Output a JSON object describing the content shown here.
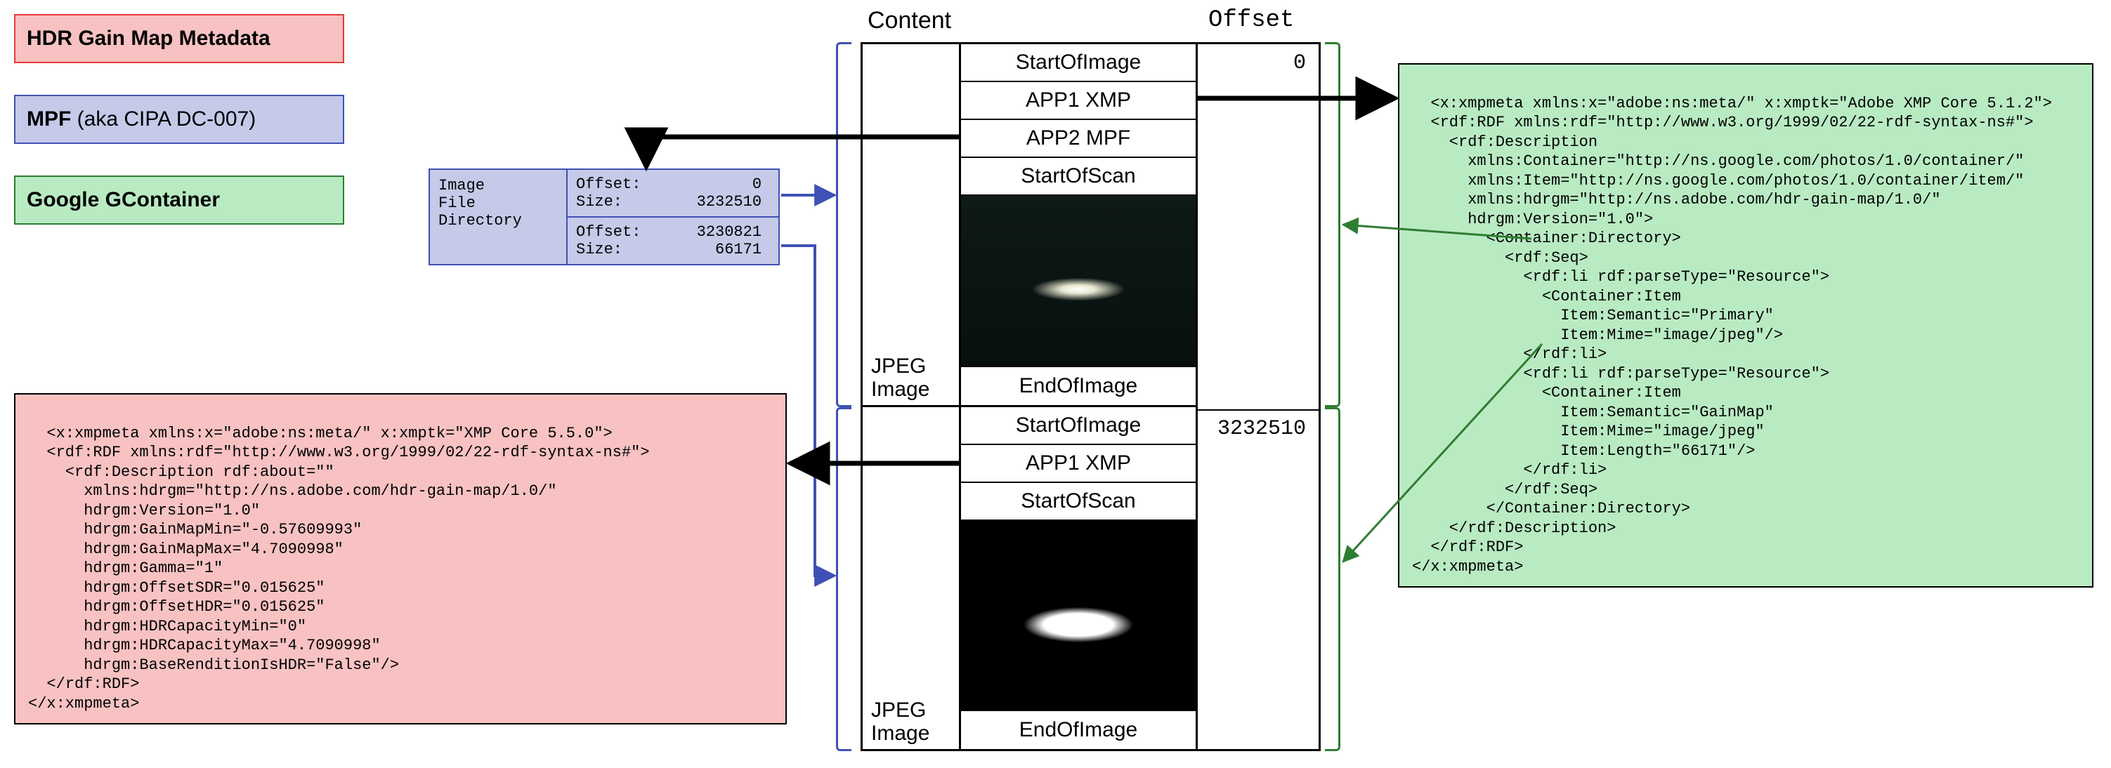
{
  "legend": {
    "hdr": "HDR Gain Map Metadata",
    "mpf_bold": "MPF",
    "mpf_plain": " (aka CIPA DC-007)",
    "gcont": "Google GContainer"
  },
  "titles": {
    "content": "Content",
    "offset": "Offset",
    "jpeg": "JPEG\nImage"
  },
  "ifd": {
    "label": "Image\nFile\nDirectory",
    "e0": "Offset:            0\nSize:        3232510",
    "e1": "Offset:      3230821\nSize:          66171"
  },
  "content": {
    "soi": "StartOfImage",
    "app1": "APP1 XMP",
    "app2": "APP2 MPF",
    "sos": "StartOfScan",
    "eoi": "EndOfImage"
  },
  "offsets": {
    "o0": "0",
    "o1": "3232510"
  },
  "xmp_hdrgm": "<x:xmpmeta xmlns:x=\"adobe:ns:meta/\" x:xmptk=\"XMP Core 5.5.0\">\n  <rdf:RDF xmlns:rdf=\"http://www.w3.org/1999/02/22-rdf-syntax-ns#\">\n    <rdf:Description rdf:about=\"\"\n      xmlns:hdrgm=\"http://ns.adobe.com/hdr-gain-map/1.0/\"\n      hdrgm:Version=\"1.0\"\n      hdrgm:GainMapMin=\"-0.57609993\"\n      hdrgm:GainMapMax=\"4.7090998\"\n      hdrgm:Gamma=\"1\"\n      hdrgm:OffsetSDR=\"0.015625\"\n      hdrgm:OffsetHDR=\"0.015625\"\n      hdrgm:HDRCapacityMin=\"0\"\n      hdrgm:HDRCapacityMax=\"4.7090998\"\n      hdrgm:BaseRenditionIsHDR=\"False\"/>\n  </rdf:RDF>\n</x:xmpmeta>",
  "xmp_gcont": "<x:xmpmeta xmlns:x=\"adobe:ns:meta/\" x:xmptk=\"Adobe XMP Core 5.1.2\">\n  <rdf:RDF xmlns:rdf=\"http://www.w3.org/1999/02/22-rdf-syntax-ns#\">\n    <rdf:Description\n      xmlns:Container=\"http://ns.google.com/photos/1.0/container/\"\n      xmlns:Item=\"http://ns.google.com/photos/1.0/container/item/\"\n      xmlns:hdrgm=\"http://ns.adobe.com/hdr-gain-map/1.0/\"\n      hdrgm:Version=\"1.0\">\n        <Container:Directory>\n          <rdf:Seq>\n            <rdf:li rdf:parseType=\"Resource\">\n              <Container:Item\n                Item:Semantic=\"Primary\"\n                Item:Mime=\"image/jpeg\"/>\n            </rdf:li>\n            <rdf:li rdf:parseType=\"Resource\">\n              <Container:Item\n                Item:Semantic=\"GainMap\"\n                Item:Mime=\"image/jpeg\"\n                Item:Length=\"66171\"/>\n            </rdf:li>\n          </rdf:Seq>\n        </Container:Directory>\n    </rdf:Description>\n  </rdf:RDF>\n</x:xmpmeta>"
}
